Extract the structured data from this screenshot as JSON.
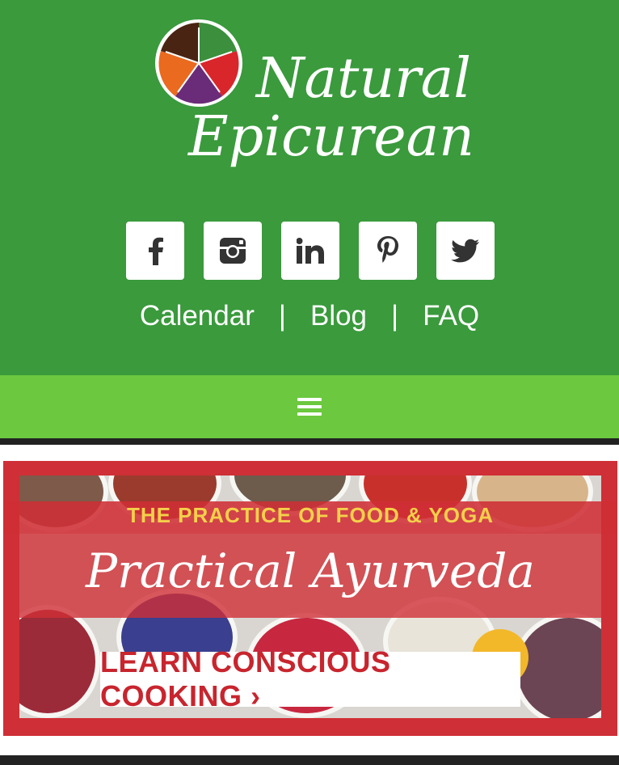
{
  "brand": {
    "name_line1": "Natural",
    "name_line2": "Epicurean",
    "logo_colors": [
      "#4a2412",
      "#3b8f3d",
      "#d9262b",
      "#6a2c78",
      "#ea6a1f"
    ]
  },
  "social": [
    {
      "name": "facebook",
      "icon": "facebook-icon"
    },
    {
      "name": "instagram",
      "icon": "instagram-icon"
    },
    {
      "name": "linkedin",
      "icon": "linkedin-icon"
    },
    {
      "name": "pinterest",
      "icon": "pinterest-icon"
    },
    {
      "name": "twitter",
      "icon": "twitter-icon"
    }
  ],
  "toplinks": {
    "calendar": "Calendar",
    "sep1": "|",
    "blog": "Blog",
    "sep2": "|",
    "faq": "FAQ"
  },
  "menu": {
    "icon": "hamburger-menu-icon"
  },
  "banner": {
    "tagline": "THE PRACTICE OF FOOD & YOGA",
    "title": "Practical Ayurveda",
    "cta": "LEARN CONSCIOUS COOKING ›"
  },
  "colors": {
    "header_bg": "#3a9a3c",
    "menubar_bg": "#6cc83f",
    "banner_red": "#cf2f36",
    "tagline_yellow": "#f4d04a"
  }
}
